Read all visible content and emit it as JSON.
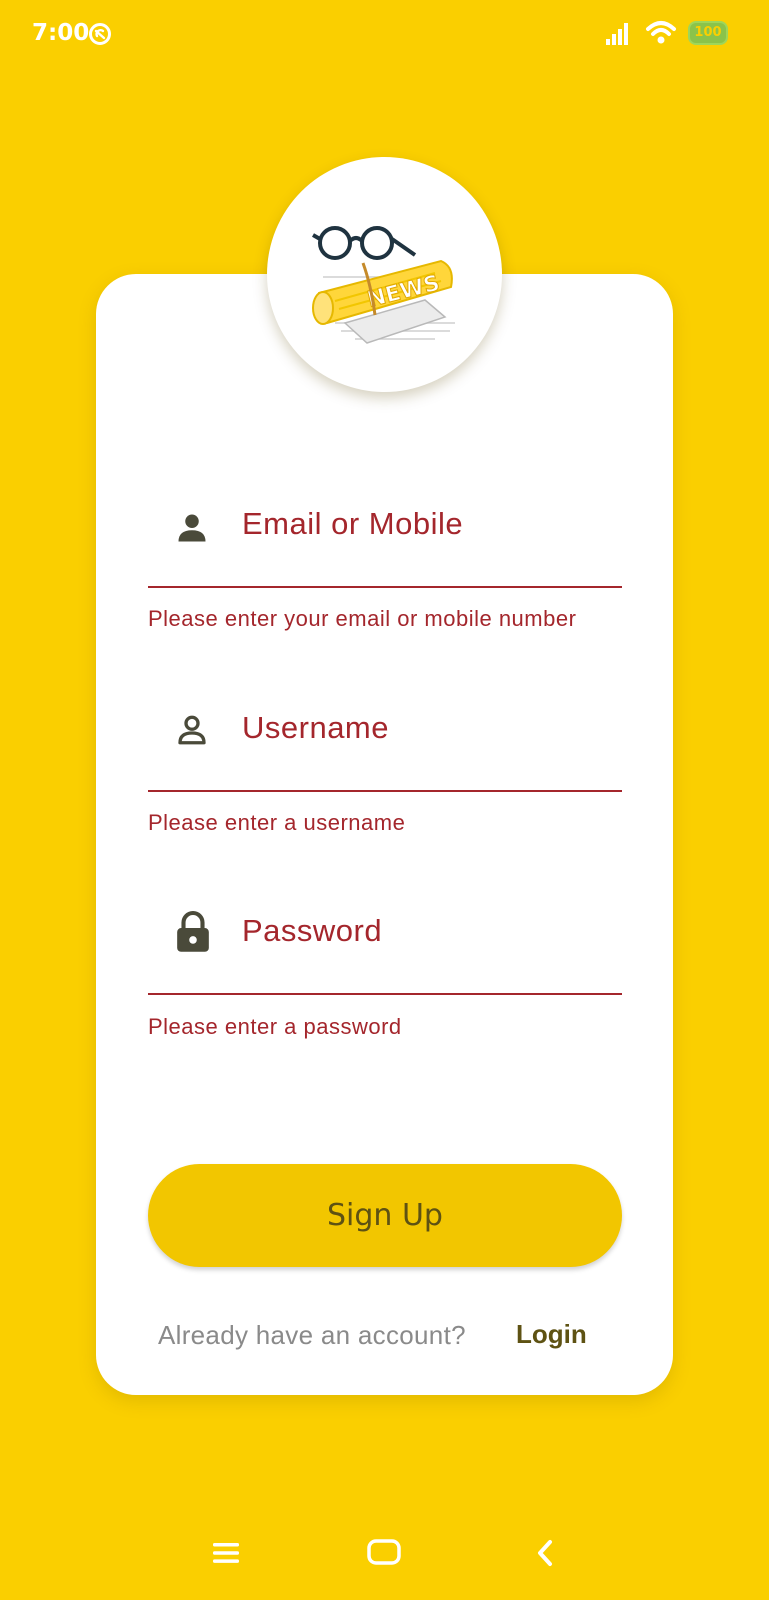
{
  "status_bar": {
    "time": "7:00",
    "battery": "100",
    "sync_icon": "sync-off-icon",
    "signal_icon": "signal-icon",
    "wifi_icon": "wifi-icon"
  },
  "logo": {
    "icon": "newspaper-glasses-logo",
    "text": "NEWS"
  },
  "form": {
    "email": {
      "label": "Email or Mobile",
      "icon": "person-filled-icon",
      "helper": "Please enter your email or mobile number"
    },
    "username": {
      "label": "Username",
      "icon": "person-outline-icon",
      "helper": "Please enter a username"
    },
    "password": {
      "label": "Password",
      "icon": "lock-icon",
      "helper": "Please enter a password"
    }
  },
  "signup_button": {
    "label": "Sign Up"
  },
  "footer": {
    "prompt": "Already have an account?",
    "login_label": "Login"
  },
  "nav_bar": {
    "menu_icon": "menu-icon",
    "home_icon": "home-icon",
    "back_icon": "back-icon"
  },
  "colors": {
    "background": "#FACF00",
    "error": "#A4262C",
    "button": "#F2C600",
    "button_text": "#5E5213",
    "muted_text": "#8A8A8A"
  }
}
